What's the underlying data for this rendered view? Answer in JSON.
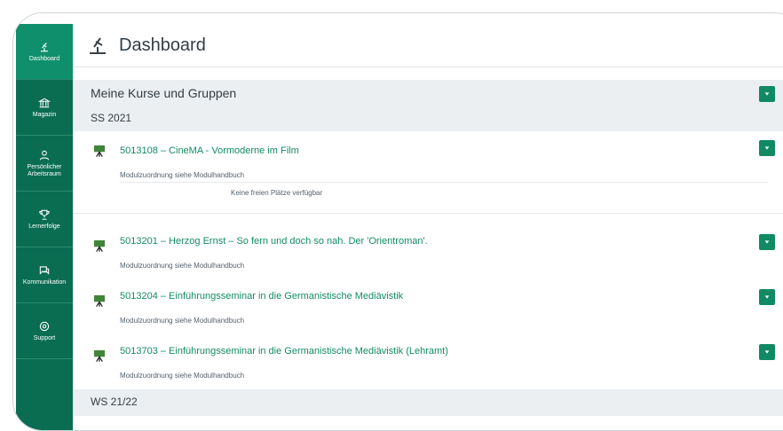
{
  "sidebar": {
    "items": [
      {
        "label": "Dashboard",
        "icon": "lamp-icon"
      },
      {
        "label": "Magazin",
        "icon": "library-icon"
      },
      {
        "label": "Persönlicher Arbeitsraum",
        "icon": "person-icon"
      },
      {
        "label": "Lernerfolge",
        "icon": "trophy-icon"
      },
      {
        "label": "Kommunikation",
        "icon": "chat-icon"
      },
      {
        "label": "Support",
        "icon": "support-icon"
      }
    ]
  },
  "header": {
    "title": "Dashboard"
  },
  "main": {
    "section_title": "Meine Kurse und Gruppen",
    "semester": "SS 2021",
    "courses": [
      {
        "title": "5013108 – CineMA - Vormoderne im Film",
        "note": "Modulzuordnung siehe Modulhandbuch",
        "places": "Keine freien Plätze verfügbar"
      },
      {
        "title": "5013201 – Herzog Ernst – So fern und doch so nah. Der 'Orientroman'.",
        "note": "Modulzuordnung siehe Modulhandbuch"
      },
      {
        "title": "5013204 – Einführungsseminar in die Germanistische Mediävistik",
        "note": "Modulzuordnung siehe Modulhandbuch"
      },
      {
        "title": "5013703 – Einführungsseminar in die Germanistische Mediävistik (Lehramt)",
        "note": "Modulzuordnung siehe Modulhandbuch"
      }
    ],
    "next_semester": "WS 21/22"
  },
  "colors": {
    "sidebar": "#0a6d52",
    "accent": "#0f8a63",
    "link": "#138b66"
  }
}
